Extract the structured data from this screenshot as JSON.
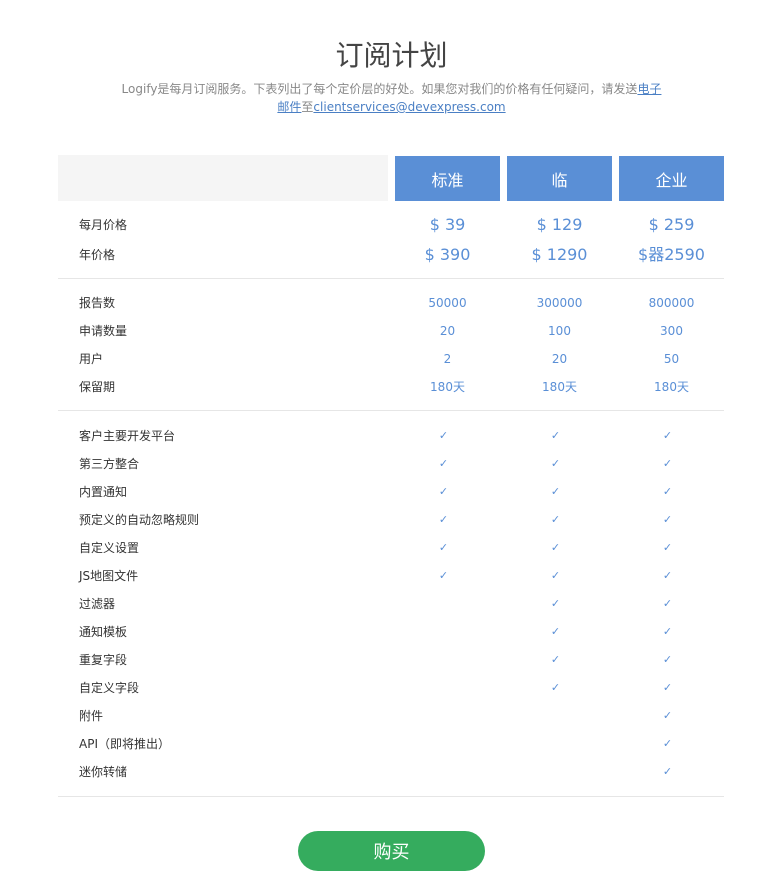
{
  "header": {
    "title": "订阅计划",
    "subtitle_text": "Logify是每月订阅服务。下表列出了每个定价层的好处。如果您对我们的价格有任何疑问，请发送",
    "subtitle_link_email": "电子邮件",
    "subtitle_connector": "至",
    "subtitle_link_address": "clientservices@devexpress.com"
  },
  "plans": [
    {
      "name": "标准"
    },
    {
      "name": "临"
    },
    {
      "name": "企业"
    }
  ],
  "pricing": [
    {
      "label": "每月价格",
      "values": [
        "$ 39",
        "$ 129",
        "$ 259"
      ]
    },
    {
      "label": "年价格",
      "values": [
        "$ 390",
        "$ 1290",
        "$器2590"
      ]
    }
  ],
  "limits": [
    {
      "label": "报告数",
      "values": [
        "50000",
        "300000",
        "800000"
      ]
    },
    {
      "label": "申请数量",
      "values": [
        "20",
        "100",
        "300"
      ]
    },
    {
      "label": "用户",
      "values": [
        "2",
        "20",
        "50"
      ]
    },
    {
      "label": "保留期",
      "values": [
        "180天",
        "180天",
        "180天"
      ]
    }
  ],
  "check_glyph": "✓",
  "features": [
    {
      "label": "客户主要开发平台",
      "included": [
        true,
        true,
        true
      ]
    },
    {
      "label": "第三方整合",
      "included": [
        true,
        true,
        true
      ]
    },
    {
      "label": "内置通知",
      "included": [
        true,
        true,
        true
      ]
    },
    {
      "label": "预定义的自动忽略规则",
      "included": [
        true,
        true,
        true
      ]
    },
    {
      "label": "自定义设置",
      "included": [
        true,
        true,
        true
      ]
    },
    {
      "label": "JS地图文件",
      "included": [
        true,
        true,
        true
      ]
    },
    {
      "label": "过滤器",
      "included": [
        false,
        true,
        true
      ]
    },
    {
      "label": "通知模板",
      "included": [
        false,
        true,
        true
      ]
    },
    {
      "label": "重复字段",
      "included": [
        false,
        true,
        true
      ]
    },
    {
      "label": "自定义字段",
      "included": [
        false,
        true,
        true
      ]
    },
    {
      "label": "附件",
      "included": [
        false,
        false,
        true
      ]
    },
    {
      "label": "API（即将推出）",
      "included": [
        false,
        false,
        true
      ]
    },
    {
      "label": "迷你转储",
      "included": [
        false,
        false,
        true
      ]
    }
  ],
  "buy_label": "购买",
  "colors": {
    "plan_header": "#5a8fd6",
    "accent_text": "#5a8fd6",
    "buy_button": "#35ac5e"
  }
}
